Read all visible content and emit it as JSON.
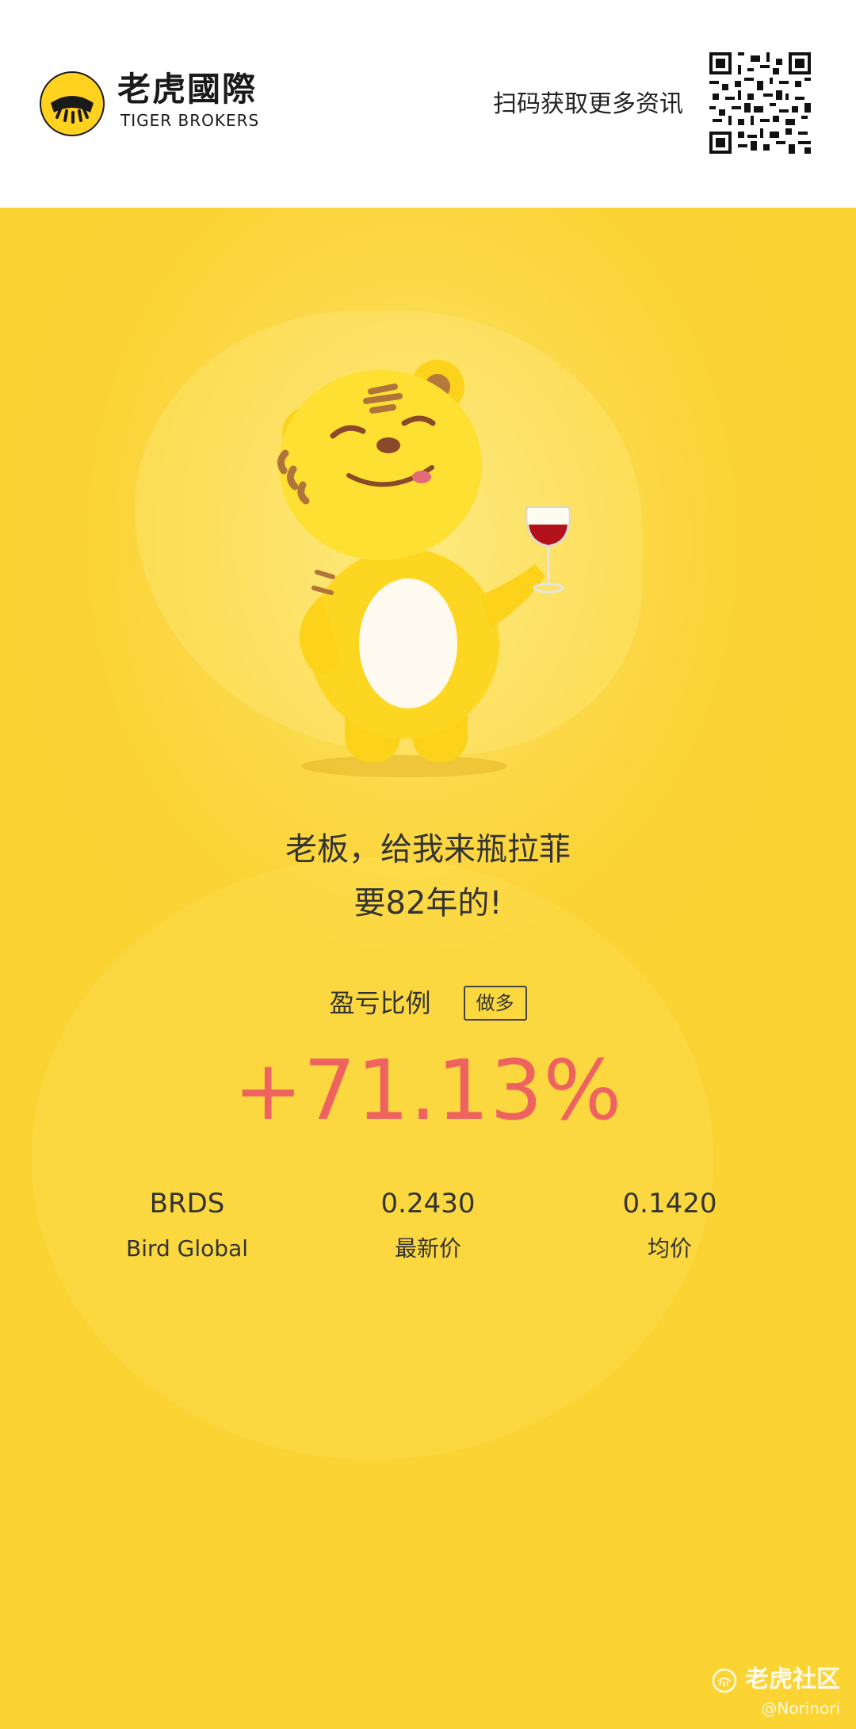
{
  "header": {
    "logo_cn": "老虎國際",
    "logo_en": "TIGER BROKERS",
    "scan_text": "扫码获取更多资讯"
  },
  "colors": {
    "brand_yellow": "#fbd334",
    "gain_red": "#ee6360",
    "text_dark": "#333333"
  },
  "main": {
    "quote": [
      "老板，给我来瓶拉菲",
      "要82年的!"
    ],
    "ratio_label": "盈亏比例",
    "ratio_badge": "做多",
    "ratio_value": "+71.13%",
    "stats": [
      {
        "top": "BRDS",
        "bottom": "Bird Global"
      },
      {
        "top": "0.2430",
        "bottom": "最新价"
      },
      {
        "top": "0.1420",
        "bottom": "均价"
      }
    ]
  },
  "watermark": {
    "brand": "老虎社区",
    "user": "@Norinori"
  }
}
